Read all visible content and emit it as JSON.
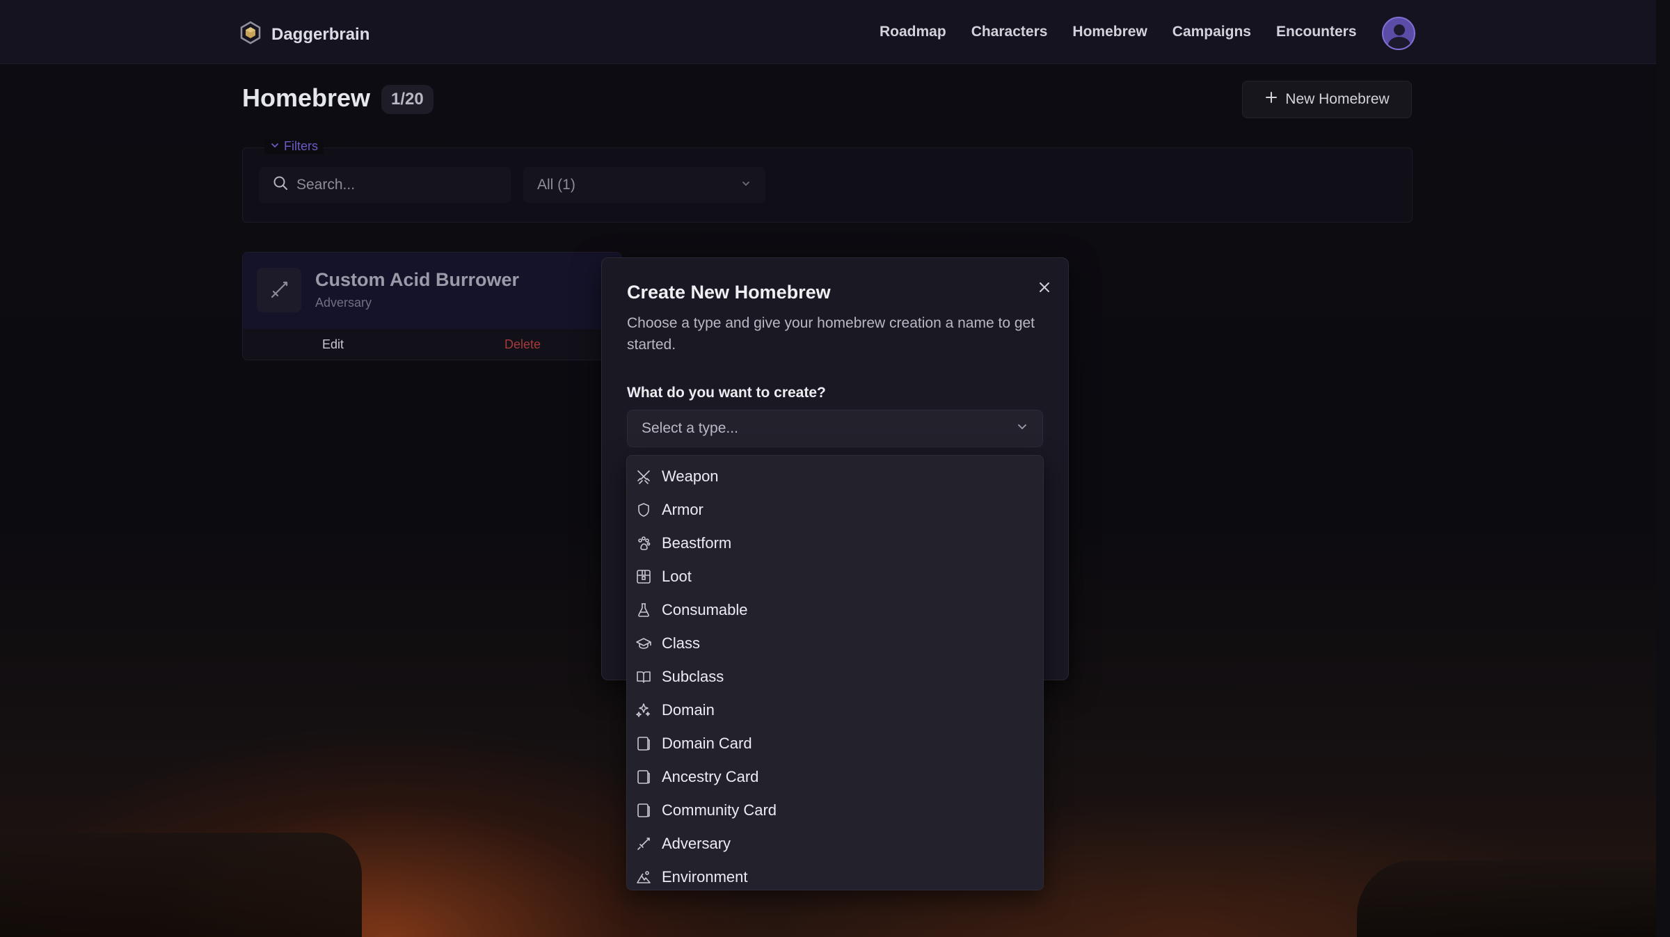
{
  "nav": {
    "brand": "Daggerbrain",
    "links": [
      "Roadmap",
      "Characters",
      "Homebrew",
      "Campaigns",
      "Encounters"
    ]
  },
  "header": {
    "title": "Homebrew",
    "count": "1/20",
    "new_button": "New Homebrew"
  },
  "filters": {
    "legend": "Filters",
    "search_placeholder": "Search...",
    "type_filter_value": "All (1)"
  },
  "card": {
    "title": "Custom Acid Burrower",
    "subtitle": "Adversary",
    "edit_label": "Edit",
    "delete_label": "Delete"
  },
  "modal": {
    "title": "Create New Homebrew",
    "description": "Choose a type and give your homebrew creation a name to get started.",
    "label": "What do you want to create?",
    "select_placeholder": "Select a type...",
    "options": [
      {
        "label": "Weapon",
        "icon": "swords-icon"
      },
      {
        "label": "Armor",
        "icon": "shield-icon"
      },
      {
        "label": "Beastform",
        "icon": "paw-icon"
      },
      {
        "label": "Loot",
        "icon": "chest-icon"
      },
      {
        "label": "Consumable",
        "icon": "flask-icon"
      },
      {
        "label": "Class",
        "icon": "graduation-cap-icon"
      },
      {
        "label": "Subclass",
        "icon": "open-book-icon"
      },
      {
        "label": "Domain",
        "icon": "sparkles-icon"
      },
      {
        "label": "Domain Card",
        "icon": "card-icon"
      },
      {
        "label": "Ancestry Card",
        "icon": "card-icon"
      },
      {
        "label": "Community Card",
        "icon": "card-icon"
      },
      {
        "label": "Adversary",
        "icon": "sword-icon"
      },
      {
        "label": "Environment",
        "icon": "mountain-icon"
      }
    ]
  },
  "colors": {
    "nav_bg": "#15131f",
    "modal_bg": "#1a1822",
    "accent": "#6a5cc4",
    "delete": "#a63a3a"
  }
}
